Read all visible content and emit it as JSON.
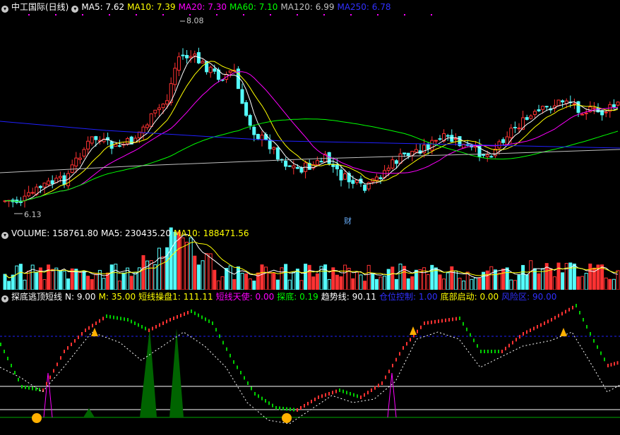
{
  "price_header": {
    "title": "中工国际(日线)",
    "ma5": "MA5: 7.62",
    "ma10": "MA10: 7.39",
    "ma20": "MA20: 7.30",
    "ma60": "MA60: 7.10",
    "ma120": "MA120: 6.99",
    "ma250": "MA250: 6.78"
  },
  "price_annotations": {
    "high": "8.08",
    "low": "6.13",
    "marker": "财"
  },
  "volume_header": {
    "volume": "VOLUME: 158761.80",
    "ma5": "MA5: 230435.20",
    "ma10": "MA10: 188471.56"
  },
  "indicator_header": {
    "name": "探底逃顶短线",
    "n": "N: 9.00",
    "m": "M: 35.00",
    "short_ops": "短线操盘1: 111.11",
    "short_angel": "短线天使: 0.00",
    "probe": "探底: 0.19",
    "trend": "趋势线: 90.11",
    "position": "仓位控制: 1.00",
    "bottom_start": "底部启动: 0.00",
    "risk": "风险区: 90.00"
  },
  "colors": {
    "up": "#ff3232",
    "down": "#54fcfc",
    "ma5": "#ffffff",
    "ma10": "#ffff00",
    "ma20": "#ff00ff",
    "ma60": "#00ff00",
    "ma120": "#c0c0c0",
    "ma250": "#2020ff",
    "panel_border": "#8b0000"
  }
}
